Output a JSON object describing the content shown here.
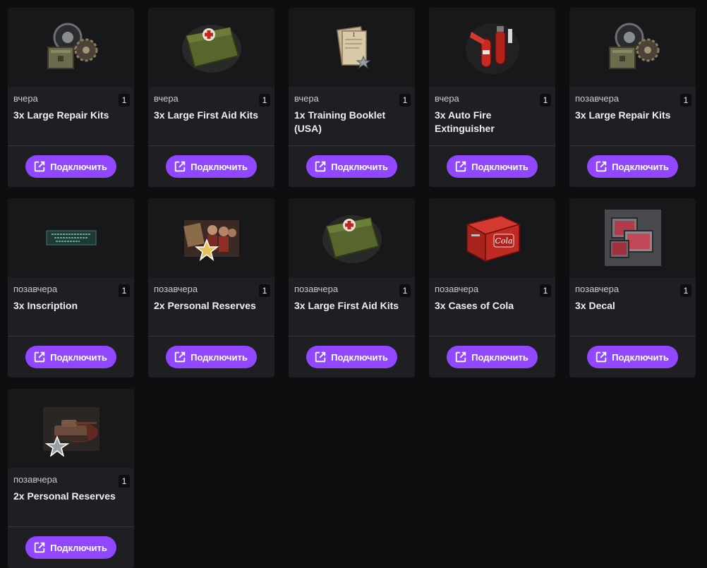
{
  "button_label": "Подключить",
  "colors": {
    "accent": "#9147ff",
    "card_bg": "#1f1f23",
    "page_bg": "#0e0e10"
  },
  "cards": [
    {
      "date": "вчера",
      "count": "1",
      "title": "3x Large Repair Kits",
      "image": "repair-kit-image"
    },
    {
      "date": "вчера",
      "count": "1",
      "title": "3x Large First Aid Kits",
      "image": "first-aid-kit-image"
    },
    {
      "date": "вчера",
      "count": "1",
      "title": "1x Training Booklet (USA)",
      "image": "training-booklet-image"
    },
    {
      "date": "вчера",
      "count": "1",
      "title": "3x Auto Fire Extinguisher",
      "image": "fire-extinguisher-image"
    },
    {
      "date": "позавчера",
      "count": "1",
      "title": "3x Large Repair Kits",
      "image": "repair-kit-image"
    },
    {
      "date": "позавчера",
      "count": "1",
      "title": "3x Inscription",
      "image": "inscription-image"
    },
    {
      "date": "позавчера",
      "count": "1",
      "title": "2x Personal Reserves",
      "image": "personal-reserves-image"
    },
    {
      "date": "позавчера",
      "count": "1",
      "title": "3x Large First Aid Kits",
      "image": "first-aid-kit-image"
    },
    {
      "date": "позавчера",
      "count": "1",
      "title": "3x Cases of Cola",
      "image": "cola-case-image"
    },
    {
      "date": "позавчера",
      "count": "1",
      "title": "3x Decal",
      "image": "decal-image"
    },
    {
      "date": "позавчера",
      "count": "1",
      "title": "2x Personal Reserves",
      "image": "tank-reserves-image"
    }
  ]
}
